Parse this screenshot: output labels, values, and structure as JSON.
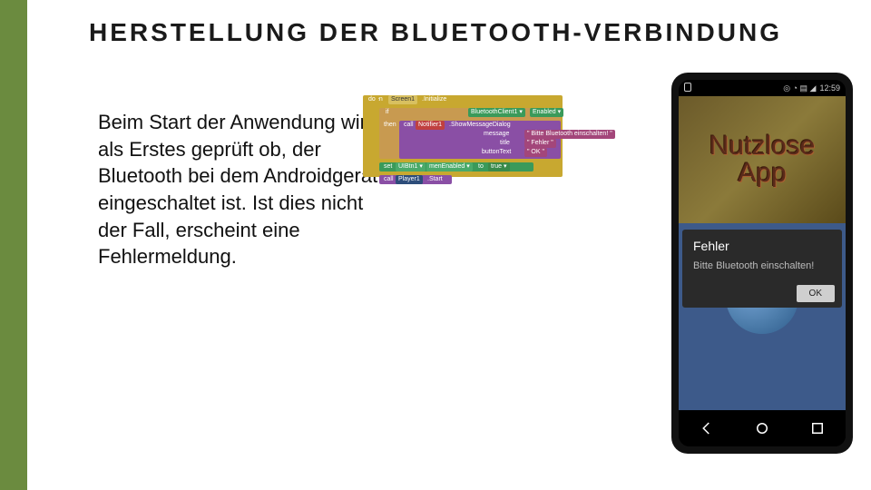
{
  "title": "HERSTELLUNG DER BLUETOOTH-VERBINDUNG",
  "body": "Beim Start der Anwendung wird als Erstes geprüft ob, der Bluetooth bei dem Androidgerät eingeschaltet ist. Ist dies nicht der Fall, erscheint eine Fehlermeldung.",
  "blocks": {
    "when": "when",
    "screen": "Screen1",
    "init": ".Initialize",
    "do": "do",
    "if": "if",
    "then": "then",
    "call1": "call",
    "notifier": "Notifier1",
    "show": ".ShowMessageDialog",
    "btc": "BluetoothClient1 ▾",
    "enabled": "Enabled ▾",
    "message_l": "message",
    "message_v": "\" Bitte Bluetooth einschalten! \"",
    "title_l": "title",
    "title_v": "\" Fehler \"",
    "btn_l": "buttonText",
    "btn_v": "\" OK \"",
    "set": "set",
    "uibtn": "UIBtn1 ▾",
    "menab": "menEnabled ▾",
    "to": "to",
    "true": "true ▾",
    "call2": "call",
    "player": "Player1",
    "start": ".Start"
  },
  "phone": {
    "status_icons": "◎ ◔ ▤ ◢",
    "status_time": "12:59",
    "app_title_1": "Nutzlose",
    "app_title_2": "App",
    "dialog_title": "Fehler",
    "dialog_msg": "Bitte Bluetooth einschalten!",
    "dialog_ok": "OK"
  }
}
